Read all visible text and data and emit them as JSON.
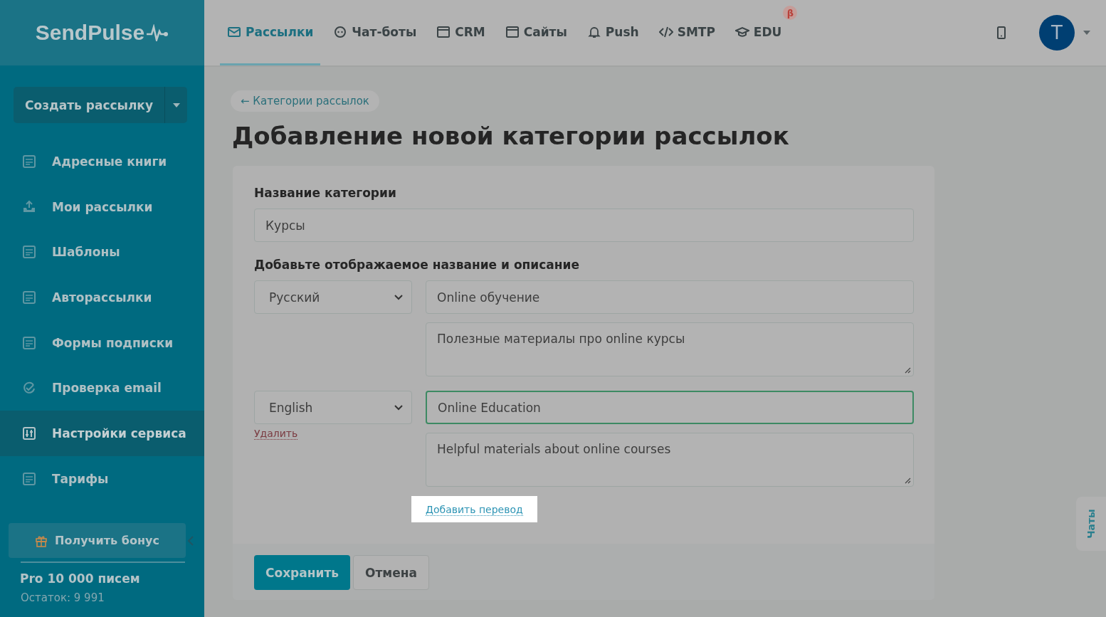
{
  "logo": {
    "text": "SendPulse"
  },
  "nav": [
    {
      "label": "Рассылки",
      "selected": true
    },
    {
      "label": "Чат-боты",
      "selected": false
    },
    {
      "label": "CRM",
      "selected": false
    },
    {
      "label": "Сайты",
      "selected": false
    },
    {
      "label": "Push",
      "selected": false
    },
    {
      "label": "SMTP",
      "selected": false
    },
    {
      "label": "EDU",
      "selected": false,
      "badge": "β"
    }
  ],
  "avatar": {
    "letter": "T"
  },
  "sidebar": {
    "create_button": "Создать рассылку",
    "items": [
      {
        "label": "Адресные книги",
        "selected": false
      },
      {
        "label": "Мои рассылки",
        "selected": false
      },
      {
        "label": "Шаблоны",
        "selected": false
      },
      {
        "label": "Авторассылки",
        "selected": false
      },
      {
        "label": "Формы подписки",
        "selected": false
      },
      {
        "label": "Проверка email",
        "selected": false
      },
      {
        "label": "Настройки сервиса",
        "selected": true
      },
      {
        "label": "Тарифы",
        "selected": false
      }
    ],
    "bonus_button": "Получить бонус",
    "plan": {
      "name": "Pro 10 000 писем",
      "remaining": "Остаток: 9 991"
    }
  },
  "breadcrumb": "← Категории рассылок",
  "title": "Добавление новой категории рассылок",
  "form": {
    "name_label": "Название категории",
    "name_value": "Курсы",
    "translations_label": "Добавьте отображаемое название и описание",
    "translations": [
      {
        "language": "Русский",
        "title": "Online обучение",
        "description": "Полезные материалы про online курсы",
        "focused": false
      },
      {
        "language": "English",
        "title": "Online Education",
        "description": "Helpful materials about online courses",
        "focused": true,
        "remove_link": "Удалить"
      }
    ],
    "add_translation": "Добавить перевод"
  },
  "buttons": [
    {
      "label": "Сохранить",
      "kind": "primary"
    },
    {
      "label": "Отмена",
      "kind": "secondary"
    }
  ],
  "chat_tab": "Чаты"
}
